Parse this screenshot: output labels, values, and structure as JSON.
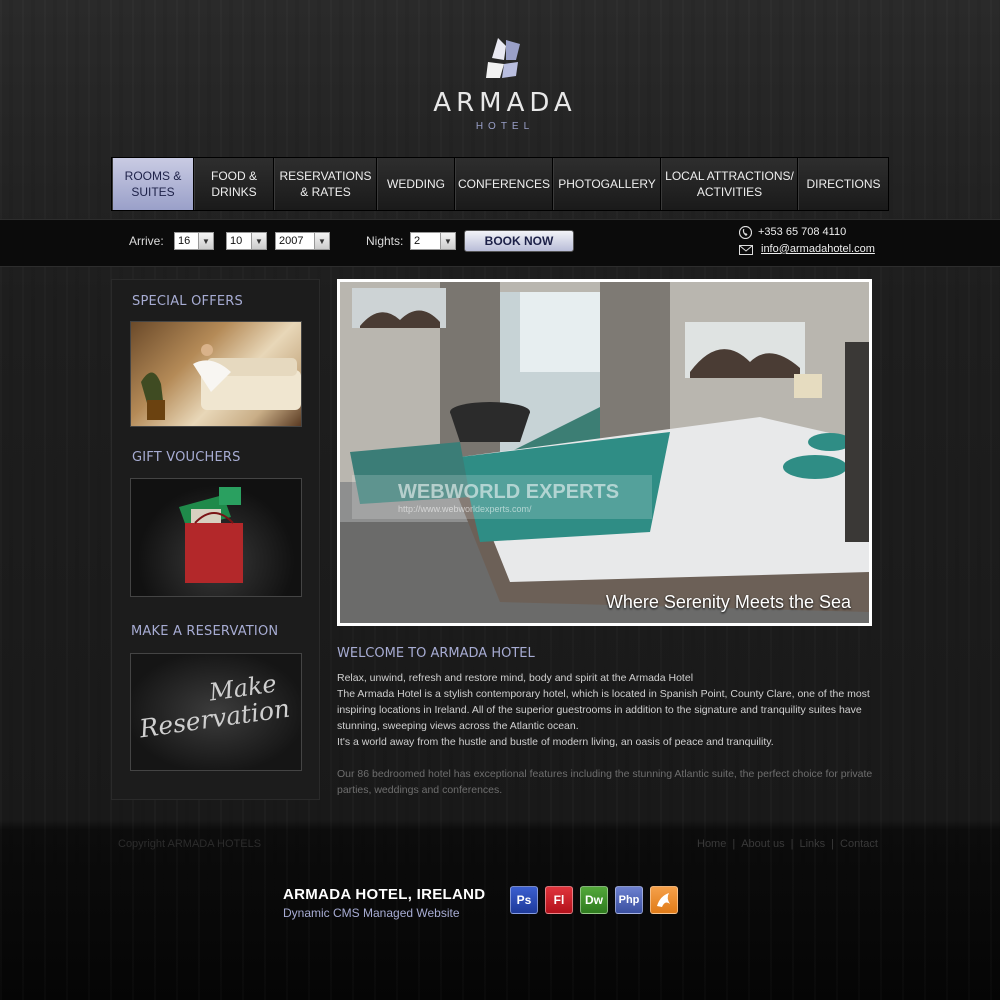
{
  "brand": {
    "name": "ARMADA",
    "subtitle": "HOTEL"
  },
  "nav": [
    {
      "line1": "ROOMS &",
      "line2": "SUITES",
      "active": true
    },
    {
      "line1": "FOOD &",
      "line2": "DRINKS"
    },
    {
      "line1": "RESERVATIONS",
      "line2": "& RATES"
    },
    {
      "line1": "WEDDING",
      "line2": ""
    },
    {
      "line1": "CONFERENCES",
      "line2": ""
    },
    {
      "line1": "PHOTOGALLERY",
      "line2": ""
    },
    {
      "line1": "LOCAL ATTRACTIONS/",
      "line2": "ACTIVITIES"
    },
    {
      "line1": "DIRECTIONS",
      "line2": ""
    }
  ],
  "booking": {
    "arrive_label": "Arrive:",
    "day": "16",
    "month": "10",
    "year": "2007",
    "nights_label": "Nights:",
    "nights": "2",
    "book_button": "BOOK NOW"
  },
  "contact": {
    "phone": "+353 65 708 4110",
    "email": "info@armadahotel.com"
  },
  "sidebar": {
    "special_offers": "SPECIAL OFFERS",
    "gift_vouchers": "GIFT  VOUCHERS",
    "make_reservation": "MAKE A RESERVATION",
    "reservation_script_line1": "Make",
    "reservation_script_line2": "Reservation"
  },
  "hero": {
    "caption": "Where Serenity Meets the Sea",
    "watermark_title": "WEBWORLD EXPERTS",
    "watermark_url": "http://www.webworldexperts.com/"
  },
  "welcome": {
    "title": "WELCOME TO ARMADA HOTEL",
    "p1": "Relax, unwind, refresh and restore mind, body and spirit at the Armada Hotel",
    "p2": "The Armada Hotel is a stylish contemporary hotel, which is located in Spanish Point, County Clare, one of the most inspiring locations in Ireland. All of the superior guestrooms in addition to the signature and tranquility suites have stunning, sweeping views across the Atlantic ocean.",
    "p3": "It's a world away from the hustle and bustle of modern living, an oasis of peace and tranquility.",
    "p4": "Our 86 bedroomed hotel has exceptional features including the stunning Atlantic suite, the perfect choice for private parties, weddings and conferences."
  },
  "footer": {
    "copyright": "Copyright ARMADA HOTELS",
    "links": [
      "Home",
      "|",
      "About us",
      "|",
      "Links",
      "|",
      "Contact"
    ]
  },
  "showcase": {
    "title": "ARMADA HOTEL, IRELAND",
    "subtitle": "Dynamic CMS Managed Website",
    "tools": [
      "Ps",
      "Fl",
      "Dw",
      "Php",
      ""
    ],
    "tool_colors": [
      "#1e3a9a",
      "#b3111b",
      "#2f7b1f",
      "#3a4fa0",
      "#e07b18"
    ]
  }
}
